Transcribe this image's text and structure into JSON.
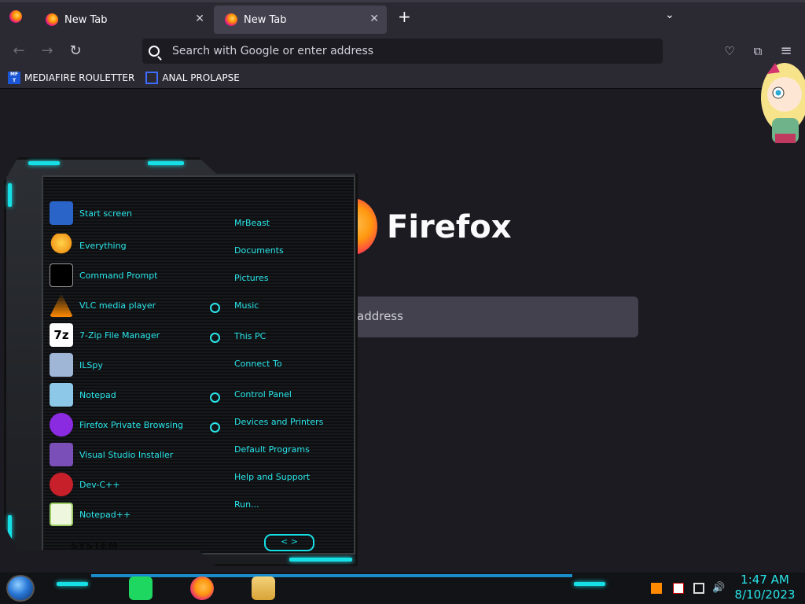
{
  "browser": {
    "tabs": [
      {
        "label": "New Tab"
      },
      {
        "label": "New Tab"
      }
    ],
    "new_tab_symbol": "+",
    "address_placeholder": "Search with Google or enter address",
    "bookmarks": [
      {
        "label": "MEDIAFIRE ROULETTER",
        "icon": "mf-icon",
        "icon_text": "MF T"
      },
      {
        "label": "ANAL PROLAPSE",
        "icon": "bookmark-icon"
      }
    ],
    "page": {
      "brand": "Firefox",
      "search_placeholder": "address"
    }
  },
  "start_menu": {
    "programs": [
      {
        "label": "Start screen",
        "icon": "start-screen-icon",
        "color": "#2a64c8"
      },
      {
        "label": "Everything",
        "icon": "magnifier-icon",
        "color": "#f29a1c"
      },
      {
        "label": "Command Prompt",
        "icon": "cmd-icon",
        "color": "#000000"
      },
      {
        "label": "VLC media player",
        "icon": "vlc-icon",
        "color": "#ff8a00"
      },
      {
        "label": "7-Zip File Manager",
        "icon": "7zip-icon",
        "color": "#ffffff"
      },
      {
        "label": "ILSpy",
        "icon": "ilspy-icon",
        "color": "#9fb6d6"
      },
      {
        "label": "Notepad",
        "icon": "notepad-icon",
        "color": "#8ec8e8"
      },
      {
        "label": "Firefox Private Browsing",
        "icon": "private-browsing-icon",
        "color": "#8a2be2"
      },
      {
        "label": "Visual Studio Installer",
        "icon": "vs-installer-icon",
        "color": "#7b4fb8"
      },
      {
        "label": "Dev-C++",
        "icon": "devcpp-icon",
        "color": "#c8202a"
      },
      {
        "label": "Notepad++",
        "icon": "notepadpp-icon",
        "color": "#9ccc65"
      }
    ],
    "places": [
      "MrBeast",
      "Documents",
      "Pictures",
      "Music",
      "This PC",
      "Connect To",
      "Control Panel",
      "Devices and Printers",
      "Default Programs",
      "Help and Support",
      "Run..."
    ],
    "system_label": "SYSTEM",
    "nav_arrows": "< >"
  },
  "taskbar": {
    "time": "1:47 AM",
    "date": "8/10/2023",
    "accent": "#29e6ea"
  }
}
